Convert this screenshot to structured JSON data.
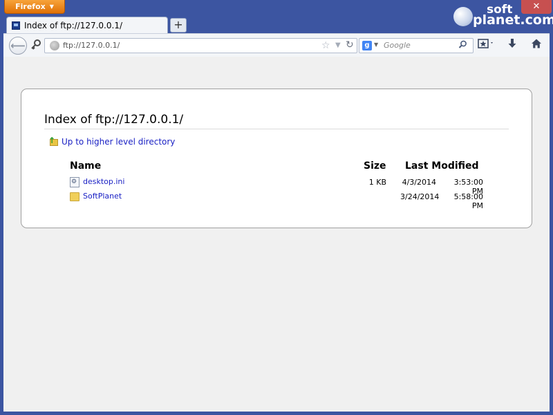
{
  "browser": {
    "menu_button_label": "Firefox",
    "menu_arrow": "▼",
    "tab_title": "Index of ftp://127.0.0.1/",
    "new_tab_label": "+",
    "back_glyph": "⟵",
    "close_glyph": "✕",
    "url": "ftp://127.0.0.1/",
    "search_placeholder": "Google",
    "search_engine_letter": "g"
  },
  "watermark": {
    "line1": "soft",
    "line2": "planet.com"
  },
  "page": {
    "heading": "Index of ftp://127.0.0.1/",
    "up_link": "Up to higher level directory",
    "columns": {
      "name": "Name",
      "size": "Size",
      "modified": "Last Modified"
    },
    "entries": [
      {
        "name": "desktop.ini",
        "type": "file",
        "size": "1 KB",
        "date": "4/3/2014",
        "time": "3:53:00 PM"
      },
      {
        "name": "SoftPlanet",
        "type": "folder",
        "size": "",
        "date": "3/24/2014",
        "time": "5:58:00 PM"
      }
    ]
  },
  "colors": {
    "frame": "#3c55a1",
    "link": "#1a21c4",
    "firefox_button": "#e07106"
  }
}
